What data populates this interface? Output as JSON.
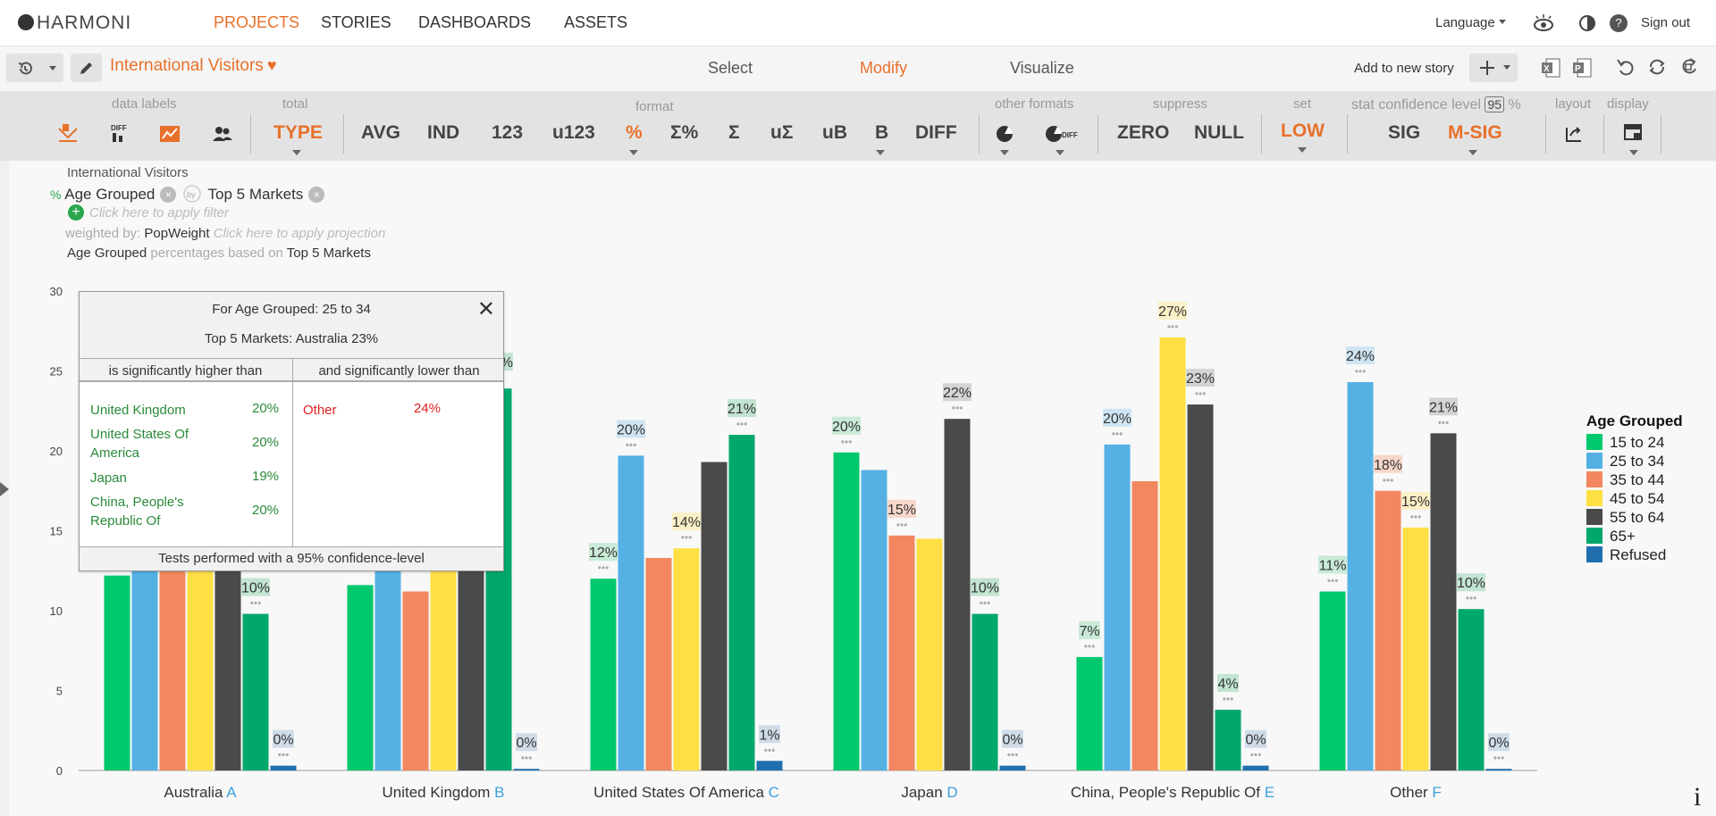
{
  "app": {
    "logo_text": "HARMONI",
    "nav": [
      "PROJECTS",
      "STORIES",
      "DASHBOARDS",
      "ASSETS"
    ],
    "active_nav": "PROJECTS",
    "language_label": "Language",
    "signout_label": "Sign out"
  },
  "report": {
    "title": "International Visitors",
    "modes": [
      "Select",
      "Modify",
      "Visualize"
    ],
    "active_mode": "Modify",
    "add_to_story": "Add to new story"
  },
  "ribbon": {
    "groups": {
      "data_labels": "data labels",
      "total": "total",
      "format": "format",
      "other_formats": "other formats",
      "suppress": "suppress",
      "set": "set",
      "stat_confidence": "stat confidence level",
      "confidence_value": "95",
      "percent_sign": "%",
      "layout": "layout",
      "display": "display"
    },
    "buttons": {
      "type": "TYPE",
      "avg": "AVG",
      "ind": "IND",
      "n123": "123",
      "u123": "u123",
      "pct": "%",
      "sigma_pct": "Σ%",
      "sigma": "Σ",
      "u_sigma": "uΣ",
      "ub": "uB",
      "b": "B",
      "diff": "DIFF",
      "zero": "ZERO",
      "null": "NULL",
      "low": "LOW",
      "sig": "SIG",
      "msig": "M-SIG",
      "diff_small": "DIFF"
    }
  },
  "spec": {
    "dataset": "International Visitors",
    "pct_sign": "%",
    "row_var": "Age Grouped",
    "by_label": "by",
    "col_var": "Top 5 Markets",
    "filter_hint": "Click here to apply filter",
    "weighted_by_label": "weighted by:",
    "weight_var": "PopWeight",
    "projection_hint": "Click here to apply projection",
    "basis_row": "Age Grouped",
    "basis_text": "percentages based on",
    "basis_col": "Top 5 Markets"
  },
  "popup": {
    "line1": "For Age Grouped: 25 to 34",
    "line2": "Top 5 Markets: Australia 23%",
    "higher_header": "is significantly higher than",
    "lower_header": "and significantly lower than",
    "higher": [
      {
        "label": "United Kingdom",
        "value": "20%"
      },
      {
        "label": "United States Of America",
        "value": "20%"
      },
      {
        "label": "Japan",
        "value": "19%"
      },
      {
        "label": "China, People's Republic Of",
        "value": "20%"
      }
    ],
    "lower": [
      {
        "label": "Other",
        "value": "24%"
      }
    ],
    "footer": "Tests performed with a 95% confidence-level"
  },
  "chart_data": {
    "type": "bar",
    "categories": [
      "Australia",
      "United Kingdom",
      "United States Of America",
      "Japan",
      "China, People's Republic Of",
      "Other"
    ],
    "category_letters": [
      "A",
      "B",
      "C",
      "D",
      "E",
      "F"
    ],
    "ylim": [
      0,
      30
    ],
    "yticks": [
      0,
      5,
      10,
      15,
      20,
      25,
      30
    ],
    "legend_title": "Age Grouped",
    "legend_position": "right",
    "series": [
      {
        "name": "15 to 24",
        "color": "#00c86e",
        "values": [
          12.2,
          11.6,
          12.0,
          19.9,
          7.1,
          11.2
        ],
        "labels": [
          "",
          "",
          "12%",
          "20%",
          "7%",
          "11%"
        ],
        "label_bg": "#c8ead6"
      },
      {
        "name": "25 to 34",
        "color": "#55b0e4",
        "values": [
          23.0,
          20.0,
          19.7,
          18.8,
          20.4,
          24.3
        ],
        "labels": [
          "",
          "",
          "20%",
          "",
          "20%",
          "24%"
        ],
        "label_bg": "#cfe4f2"
      },
      {
        "name": "35 to 44",
        "color": "#f28760",
        "values": [
          13.0,
          11.2,
          13.3,
          14.7,
          18.1,
          17.5
        ],
        "labels": [
          "",
          "",
          "",
          "15%",
          "",
          "18%"
        ],
        "label_bg": "#f6d7c9"
      },
      {
        "name": "45 to 54",
        "color": "#ffe044",
        "values": [
          14.5,
          15.0,
          13.9,
          14.5,
          27.1,
          15.2
        ],
        "labels": [
          "",
          "",
          "14%",
          "",
          "27%",
          "15%"
        ],
        "label_bg": "#fbf0c6"
      },
      {
        "name": "55 to 64",
        "color": "#4a4a4a",
        "values": [
          14.0,
          16.0,
          19.3,
          22.0,
          22.9,
          21.1
        ],
        "labels": [
          "",
          "",
          "",
          "22%",
          "23%",
          "21%"
        ],
        "label_bg": "#d4d4d4"
      },
      {
        "name": "65+",
        "color": "#00a86b",
        "values": [
          9.8,
          23.9,
          21.0,
          9.8,
          3.8,
          10.1
        ],
        "labels": [
          "10%",
          "24%",
          "21%",
          "10%",
          "4%",
          "10%"
        ],
        "label_bg": "#c2e4d2"
      },
      {
        "name": "Refused",
        "color": "#1f6fae",
        "values": [
          0.3,
          0.1,
          0.6,
          0.3,
          0.3,
          0.1
        ],
        "labels": [
          "0%",
          "0%",
          "1%",
          "0%",
          "0%",
          "0%"
        ],
        "label_bg": "#cfdce8"
      }
    ]
  }
}
